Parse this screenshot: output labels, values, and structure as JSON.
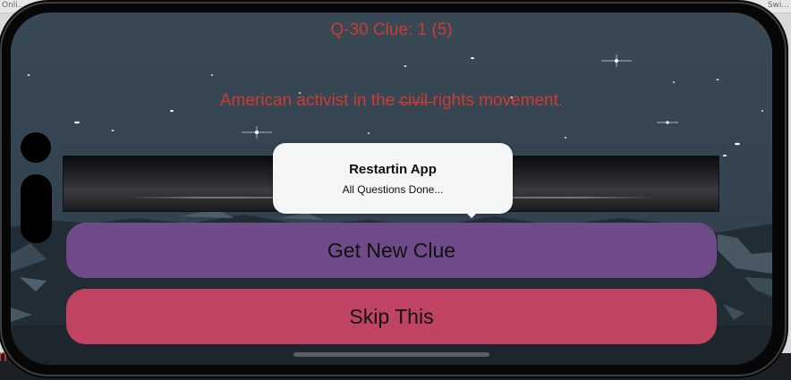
{
  "browser": {
    "tab_left": "Onli...",
    "tab_right": "Swi..."
  },
  "edge_text": "n",
  "app": {
    "clue_header": "Q-30 Clue: 1 (5)",
    "clue_text": "American activist in the civil rights movement.",
    "answer_display": "",
    "buttons": {
      "get_new_clue": "Get New Clue",
      "skip": "Skip This"
    }
  },
  "toast": {
    "title": "Restartin App",
    "message": "All Questions Done..."
  },
  "colors": {
    "text_accent": "#cc3b35",
    "get_new_clue_button": "#6f4a89",
    "skip_button": "#c04462",
    "background": "#384855",
    "toast_background": "#f4f5f5"
  },
  "icons": {
    "camera": "camera-dot-icon",
    "island": "dynamic-island-icon"
  }
}
